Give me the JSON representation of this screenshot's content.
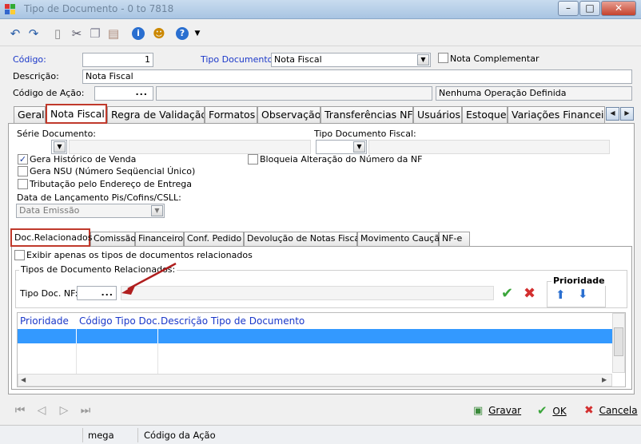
{
  "window": {
    "title": "Tipo de Documento - 0 to 7818"
  },
  "colors": {
    "accent_blue": "#1a37c9",
    "selected_row": "#3399ff",
    "highlight_border": "#c0392b"
  },
  "toolbar": {
    "icons": [
      "undo-icon",
      "redo-icon",
      "new-document-icon",
      "cut-icon",
      "copy-icon",
      "paste-icon",
      "info-icon",
      "user-icon",
      "help-icon"
    ]
  },
  "header": {
    "codigo_label": "Código:",
    "codigo_value": "1",
    "tipo_documento_label": "Tipo Documento:",
    "tipo_documento_value": "Nota Fiscal",
    "nota_complementar_label": "Nota Complementar",
    "descricao_label": "Descrição:",
    "descricao_value": "Nota Fiscal",
    "codigo_acao_label": "Código de Ação:",
    "ellipsis": "...",
    "operacao_value": "Nenhuma Operação Definida"
  },
  "tabs": [
    "Geral",
    "Nota Fiscal",
    "Regra de Validação",
    "Formatos",
    "Observação",
    "Transferências NF",
    "Usuários",
    "Estoque",
    "Variações Financeiras"
  ],
  "nota_fiscal": {
    "serie_documento_label": "Série Documento:",
    "tipo_doc_fiscal_label": "Tipo Documento Fiscal:",
    "gera_historico_label": "Gera Histórico de Venda",
    "gera_nsu_label": "Gera NSU (Número Seqüencial Único)",
    "tributacao_label": "Tributação pelo Endereço de Entrega",
    "bloqueia_label": "Bloqueia Alteração do Número da NF",
    "data_lancamento_label": "Data de Lançamento Pis/Cofins/CSLL:",
    "data_lancamento_value": "Data Emissão"
  },
  "subtabs": [
    "Doc.Relacionados",
    "Comissão",
    "Financeiro",
    "Conf. Pedido",
    "Devolução de Notas Fiscais",
    "Movimento Caução",
    "NF-e"
  ],
  "doc_relacionados": {
    "exibir_label": "Exibir apenas os tipos de documentos relacionados",
    "group_label": "Tipos de Documento Relacionados:",
    "tipo_doc_nf_label": "Tipo Doc. NF:",
    "prioridade_label": "Prioridade",
    "columns": [
      "Prioridade",
      "Código Tipo Doc.",
      "Descrição Tipo de Documento"
    ]
  },
  "footer": {
    "gravar": "Gravar",
    "ok": "OK",
    "cancelar": "Cancela"
  },
  "status": {
    "user": "mega",
    "field": "Código da Ação"
  }
}
